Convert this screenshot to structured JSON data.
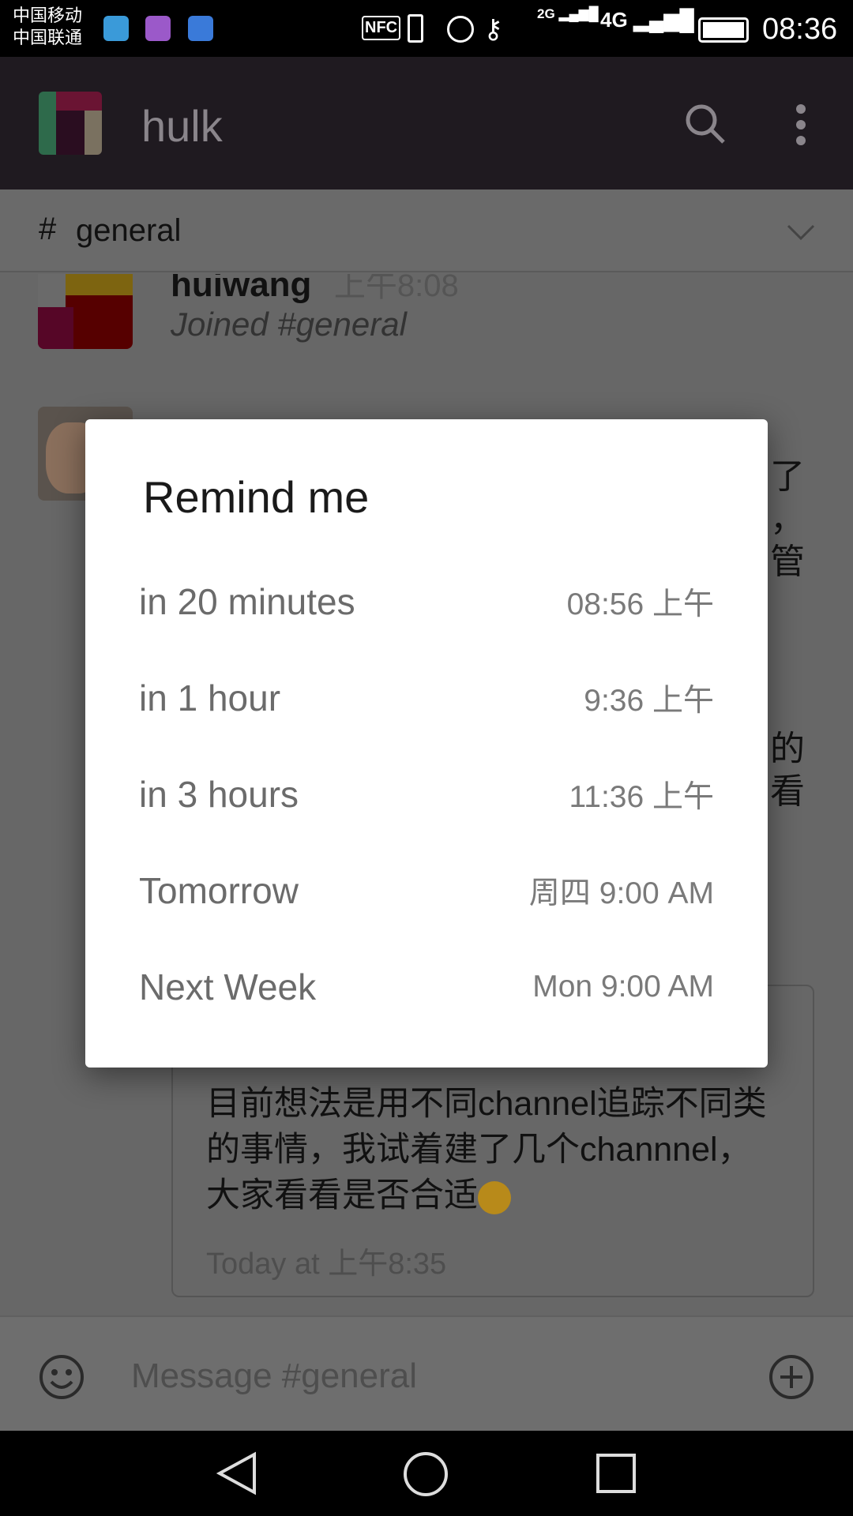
{
  "status_bar": {
    "carrier1": "中国移动",
    "carrier2": "中国联通",
    "icons": [
      "heart-app-icon",
      "gallery-icon",
      "wifi-app-icon",
      "nfc-icon",
      "vibrate-icon",
      "alarm-icon",
      "vpn-key-icon",
      "signal-2g-icon",
      "signal-4g-icon",
      "battery-icon"
    ],
    "nfc": "NFC",
    "net1": "2G",
    "net2": "4G",
    "time": "08:36"
  },
  "app_bar": {
    "team": "hulk"
  },
  "channel": {
    "name": "general",
    "hash": "#"
  },
  "messages": [
    {
      "user": "huiwang",
      "time": "上午8:08",
      "text": "Joined #general"
    }
  ],
  "partial_text": [
    "了",
    "，",
    "管",
    "的",
    "看"
  ],
  "shared_card": {
    "text": [
      "目前想法是用不同channel追踪不同类",
      "的事情，我试着建了几个channnel，",
      "大家看看是否合适"
    ],
    "time": "Today at 上午8:35"
  },
  "composer": {
    "placeholder": "Message #general"
  },
  "dialog": {
    "title": "Remind me",
    "options": [
      {
        "label": "in 20 minutes",
        "time": "08:56 上午"
      },
      {
        "label": "in 1 hour",
        "time": "9:36 上午"
      },
      {
        "label": "in 3 hours",
        "time": "11:36 上午"
      },
      {
        "label": "Tomorrow",
        "time": "周四 9:00 AM"
      },
      {
        "label": "Next Week",
        "time": "Mon 9:00 AM"
      }
    ]
  },
  "colors": {
    "app_bar": "#1f1a20",
    "overlay_bg": "#676767",
    "dialog_bg": "#ffffff"
  }
}
